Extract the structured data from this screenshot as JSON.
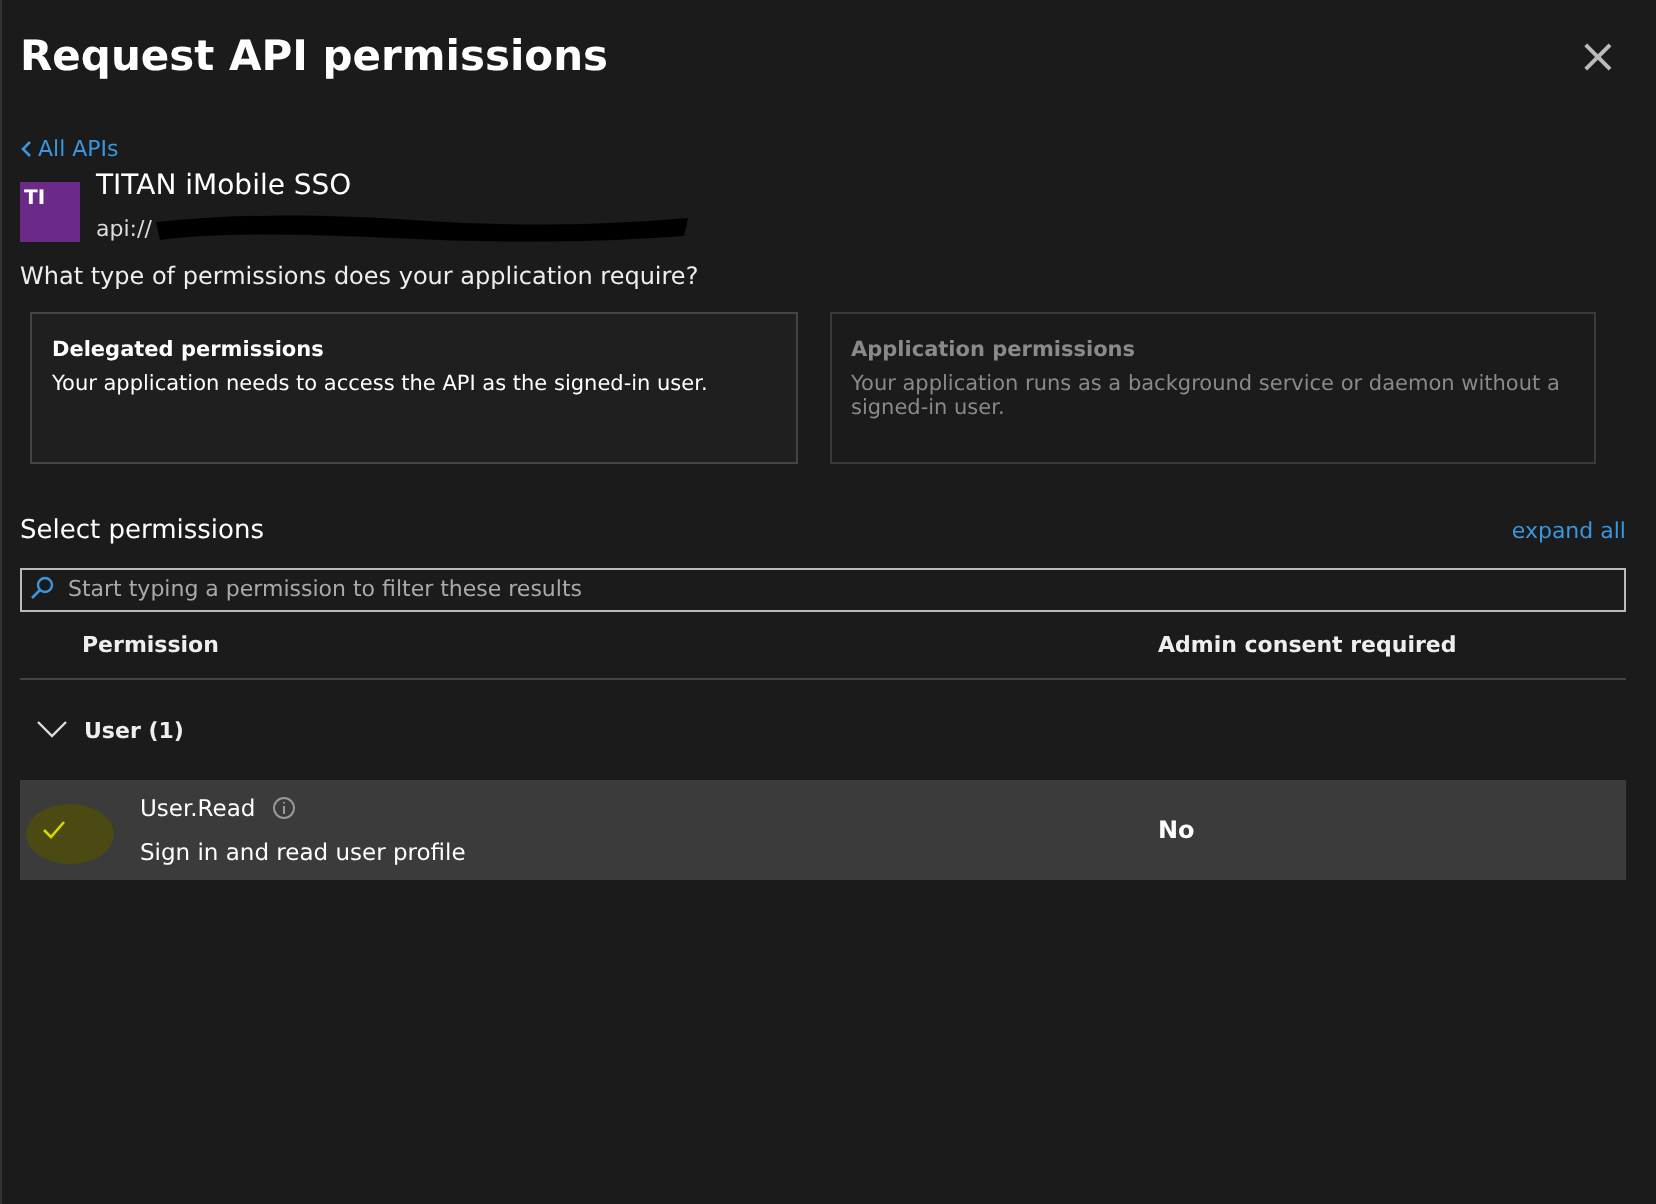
{
  "panel": {
    "title": "Request API permissions",
    "close": "×"
  },
  "back_link": "All APIs",
  "api": {
    "initials": "TI",
    "name": "TITAN iMobile SSO",
    "uri": "api://"
  },
  "question": "What type of permissions does your application require?",
  "permission_types": [
    {
      "title": "Delegated permissions",
      "description": "Your application needs to access the API as the signed-in user.",
      "selected": true
    },
    {
      "title": "Application permissions",
      "description": "Your application runs as a background service or daemon without a signed-in user.",
      "selected": false
    }
  ],
  "select_heading": "Select permissions",
  "expand_all": "expand all",
  "search": {
    "placeholder": "Start typing a permission to filter these results"
  },
  "table": {
    "columns": [
      "Permission",
      "Admin consent required"
    ],
    "groups": [
      {
        "label": "User (1)",
        "expanded": true,
        "rows": [
          {
            "name": "User.Read",
            "description": "Sign in and read user profile",
            "admin_consent": "No",
            "checked": true
          }
        ]
      }
    ]
  }
}
